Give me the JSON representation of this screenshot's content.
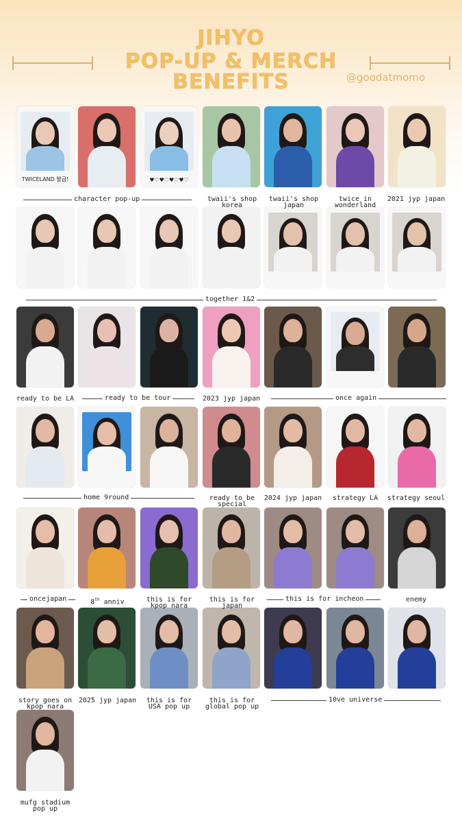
{
  "header": {
    "title_line1": "JIHYO",
    "title_line2": "POP-UP & MERCH",
    "title_line3": "BENEFITS",
    "handle": "@goodatmomo"
  },
  "cards": [
    {
      "id": "c1",
      "bg": "#f4f4f4",
      "skin": "#e9c9b6",
      "top": "#9cc4e4",
      "frame": "polaroid",
      "caption": "TWICELAND 발급!"
    },
    {
      "id": "c2",
      "bg": "#d86f6b",
      "skin": "#ecc9b4",
      "top": "#e8edf2"
    },
    {
      "id": "c3",
      "bg": "#f4f4f4",
      "skin": "#ecd0bf",
      "top": "#88bde6",
      "frame": "polaroid",
      "caption": "♥♡♥♡♥♡♥♡"
    },
    {
      "id": "c4",
      "bg": "#a7c7a4",
      "skin": "#e8c3ac",
      "top": "#c8dff2"
    },
    {
      "id": "c5",
      "bg": "#3fa2d6",
      "skin": "#e0b79d",
      "top": "#2b5dab"
    },
    {
      "id": "c6",
      "bg": "#e3c9c9",
      "skin": "#eac7b6",
      "top": "#6d4aa8"
    },
    {
      "id": "c7",
      "bg": "#f2e2c7",
      "skin": "#ebc8b0",
      "top": "#f3f1e4"
    },
    {
      "id": "c8",
      "bg": "#f6f6f6",
      "skin": "#e8c8b5",
      "top": "#f2f2f2"
    },
    {
      "id": "c9",
      "bg": "#f6f6f6",
      "skin": "#e8c8b5",
      "top": "#f2f2f2"
    },
    {
      "id": "c10",
      "bg": "#f6f6f6",
      "skin": "#e8c8b5",
      "top": "#f2f2f2"
    },
    {
      "id": "c11",
      "bg": "#f2f2f2",
      "skin": "#e8c8b5",
      "top": "#f2f2f2"
    },
    {
      "id": "c12",
      "bg": "#d8d4cf",
      "skin": "#e4c1ad",
      "top": "#f2f2f2",
      "frame": "polaroid"
    },
    {
      "id": "c13",
      "bg": "#d8d4cf",
      "skin": "#e4c1ad",
      "top": "#f2f2f2",
      "frame": "polaroid"
    },
    {
      "id": "c14",
      "bg": "#d8d4cf",
      "skin": "#e4c1ad",
      "top": "#f2f2f2",
      "frame": "polaroid"
    },
    {
      "id": "c15",
      "bg": "#3b3b3b",
      "skin": "#d9a990",
      "top": "#f2f2f2"
    },
    {
      "id": "c16",
      "bg": "#e9e4e6",
      "skin": "#e7c0b1",
      "top": "#ede2e6"
    },
    {
      "id": "c17",
      "bg": "#1f2d33",
      "skin": "#dcb3a2",
      "top": "#1a1a1a"
    },
    {
      "id": "c18",
      "bg": "#ef9fbf",
      "skin": "#ecc8b3",
      "top": "#f8f3ee"
    },
    {
      "id": "c19",
      "bg": "#6b5a4c",
      "skin": "#deb199",
      "top": "#2a2a2a"
    },
    {
      "id": "c20",
      "bg": "#f4f4f4",
      "skin": "#d9ab95",
      "top": "#2d2d2d",
      "frame": "polaroid"
    },
    {
      "id": "c21",
      "bg": "#7c6a55",
      "skin": "#d7a689",
      "top": "#2a2a2a"
    },
    {
      "id": "c22",
      "bg": "#f0ece8",
      "skin": "#e2b9a5",
      "top": "#e4e9ef"
    },
    {
      "id": "c23",
      "bg": "#3f90d8",
      "skin": "#e4bea8",
      "top": "#f6f6f6",
      "frame": "polaroid"
    },
    {
      "id": "c24",
      "bg": "#c8b5a4",
      "skin": "#dcb29c",
      "top": "#f6f6f6"
    },
    {
      "id": "c25",
      "bg": "#cf8b8e",
      "skin": "#e0b39a",
      "top": "#2a2a2a"
    },
    {
      "id": "c26",
      "bg": "#b49a86",
      "skin": "#e2bba3",
      "top": "#f3eee7"
    },
    {
      "id": "c27",
      "bg": "#f6f6f6",
      "skin": "#e3b8a2",
      "top": "#b8272f"
    },
    {
      "id": "c28",
      "bg": "#f1f1f1",
      "skin": "#e3b8a2",
      "top": "#e86aa6"
    },
    {
      "id": "c29",
      "bg": "#f3f0ea",
      "skin": "#e5bea9",
      "top": "#ede5da"
    },
    {
      "id": "c30",
      "bg": "#b8857a",
      "skin": "#e4bca7",
      "top": "#e7a03a"
    },
    {
      "id": "c31",
      "bg": "#8a6cd0",
      "skin": "#e6bfae",
      "top": "#2e4a2b"
    },
    {
      "id": "c32",
      "bg": "#bcb4ab",
      "skin": "#e0b7a1",
      "top": "#b59d83"
    },
    {
      "id": "c33",
      "bg": "#9e8b84",
      "skin": "#e4bda7",
      "top": "#8d7bd2"
    },
    {
      "id": "c34",
      "bg": "#9e8b84",
      "skin": "#e4bda7",
      "top": "#8d7bd2"
    },
    {
      "id": "c35",
      "bg": "#3b3b3b",
      "skin": "#dcb09a",
      "top": "#d5d5d5"
    },
    {
      "id": "c36",
      "bg": "#6d5a4f",
      "skin": "#e2b69e",
      "top": "#c8a37c"
    },
    {
      "id": "c37",
      "bg": "#2d4d36",
      "skin": "#e4bda7",
      "top": "#3b6a45"
    },
    {
      "id": "c38",
      "bg": "#a9b0b8",
      "skin": "#e4bda7",
      "top": "#6e8fc5"
    },
    {
      "id": "c39",
      "bg": "#c0b6ae",
      "skin": "#e4bda7",
      "top": "#8fa4c8"
    },
    {
      "id": "c40",
      "bg": "#3e3a4f",
      "skin": "#e0b7a1",
      "top": "#233f9a"
    },
    {
      "id": "c41",
      "bg": "#7c8796",
      "skin": "#e0b7a1",
      "top": "#233f9a"
    },
    {
      "id": "c42",
      "bg": "#dfe2e8",
      "skin": "#e0b7a1",
      "top": "#233f9a"
    },
    {
      "id": "c43",
      "bg": "#8c7a74",
      "skin": "#e2b7a0",
      "top": "#f2f2f2"
    }
  ],
  "singles": {
    "twaii_korea": "twaii's shop korea",
    "twaii_japan": "twaii's shop japan",
    "wonderland": "twice in wonderland",
    "jyp2021": "2021 jyp japan",
    "la": "ready to be LA",
    "jyp2023": "2023 jyp japan",
    "special": "ready to be special",
    "jyp2024": "2024 jyp japan",
    "strategy_la": "strategy LA",
    "strategy_seoul": "strategy seoul",
    "anniv": "8th anniv",
    "kpopnara": "this is for kpop nara",
    "japan": "this is for japan",
    "enemy": "enemy",
    "story": "story goes on kpop nara",
    "jyp2025": "2025 jyp japan",
    "usa": "this is for USA pop up",
    "global": "this is for global pop up",
    "mufg": "mufg stadium pop up"
  },
  "groups": {
    "character": "character pop-up",
    "together": "together 1&2",
    "tour": "ready to be tour",
    "once_again": "once again",
    "home": "home 9round",
    "oncejapan": "oncejapan",
    "incheon": "this is for incheon",
    "universe": "10ve universe"
  }
}
